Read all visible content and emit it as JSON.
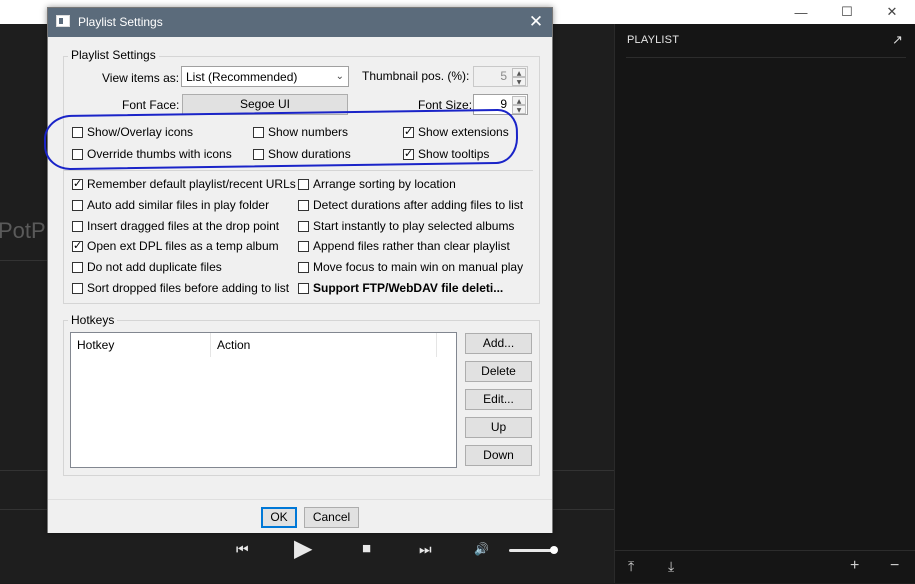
{
  "app": {
    "potplayer_partial_text": "PotP",
    "window_controls": {
      "minimize": "—",
      "maximize": "☐",
      "close": "✕"
    }
  },
  "playlist_panel": {
    "title": "PLAYLIST",
    "expand_icon": "↗",
    "bottom_buttons": {
      "move_top": "⤒",
      "move_bottom": "⤓",
      "add": "+",
      "remove": "−"
    }
  },
  "player_controls": {
    "prev": "⏮",
    "play": "▶",
    "stop": "■",
    "next": "⏭",
    "volume": "🔊"
  },
  "dialog": {
    "title": "Playlist Settings",
    "close": "✕",
    "group_label": "Playlist Settings",
    "view_items_label": "View items as:",
    "view_items_value": "List (Recommended)",
    "thumbnail_pos_label": "Thumbnail pos. (%):",
    "thumbnail_pos_value": "5",
    "font_face_label": "Font Face:",
    "font_face_value": "Segoe UI",
    "font_size_label": "Font Size:",
    "font_size_value": "9",
    "checkboxes_top": [
      {
        "label": "Show/Overlay icons",
        "checked": false
      },
      {
        "label": "Show numbers",
        "checked": false
      },
      {
        "label": "Show extensions",
        "checked": true
      },
      {
        "label": "Override thumbs with icons",
        "checked": false
      },
      {
        "label": "Show durations",
        "checked": false
      },
      {
        "label": "Show tooltips",
        "checked": true
      }
    ],
    "checkboxes_main": [
      {
        "label": "Remember default playlist/recent URLs",
        "checked": true
      },
      {
        "label": "Arrange sorting by location",
        "checked": false
      },
      {
        "label": "Auto add similar files in play folder",
        "checked": false
      },
      {
        "label": "Detect durations after adding files to list",
        "checked": false
      },
      {
        "label": "Insert dragged files at the drop point",
        "checked": false
      },
      {
        "label": "Start instantly to play selected albums",
        "checked": false
      },
      {
        "label": "Open ext DPL files as a temp album",
        "checked": true
      },
      {
        "label": "Append files rather than clear playlist",
        "checked": false
      },
      {
        "label": "Do not add duplicate files",
        "checked": false
      },
      {
        "label": "Move focus to main win on manual play",
        "checked": false
      },
      {
        "label": "Sort dropped files before adding to list",
        "checked": false
      },
      {
        "label": "Support FTP/WebDAV file deleti...",
        "checked": false,
        "bold": true
      }
    ],
    "hotkeys_label": "Hotkeys",
    "hotkeys_columns": [
      "Hotkey",
      "Action"
    ],
    "hotkey_buttons": [
      "Add...",
      "Delete",
      "Edit...",
      "Up",
      "Down"
    ],
    "ok_label": "OK",
    "cancel_label": "Cancel",
    "annotation_color": "#1a24c8"
  }
}
